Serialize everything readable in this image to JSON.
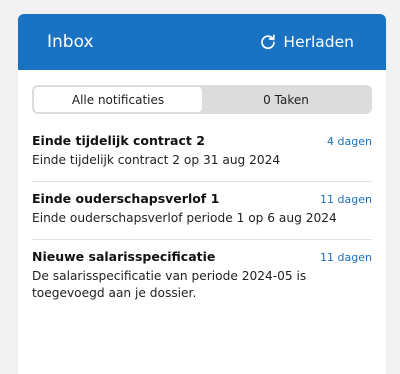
{
  "header": {
    "title": "Inbox",
    "reload_label": "Herladen",
    "reload_icon": "refresh-icon",
    "color": "#1a73c2"
  },
  "tabs": [
    {
      "label": "Alle notificaties",
      "active": true
    },
    {
      "label": "0 Taken",
      "active": false
    }
  ],
  "notifications": [
    {
      "title": "Einde tijdelijk contract 2",
      "time": "4 dagen",
      "description": "Einde tijdelijk contract 2 op 31 aug 2024"
    },
    {
      "title": "Einde ouderschapsverlof 1",
      "time": "11 dagen",
      "description": "Einde ouderschapsverlof periode 1 op 6 aug 2024"
    },
    {
      "title": "Nieuwe salarisspecificatie",
      "time": "11 dagen",
      "description": "De salarisspecificatie van periode 2024-05 is toegevoegd aan je dossier."
    }
  ]
}
